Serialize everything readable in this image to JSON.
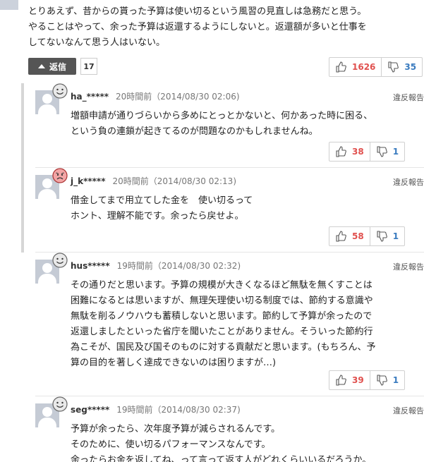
{
  "main": {
    "text": "とりあえず、昔からの貰った予算は使い切るという風習の見直しは急務だと思う。\nやることはやって、余った予算は返還するようにしないと。返還額が多いと仕事を\nしてないなんて思う人はいない。",
    "reply_label": "返信",
    "reply_count": "17",
    "good": "1626",
    "bad": "35"
  },
  "replies": [
    {
      "user": "ha_*****",
      "meta": "20時間前（2014/08/30 02:06)",
      "report": "違反報告",
      "mood": "neutral",
      "text": "増額申請が通りづらいから多めにとっとかないと、何かあった時に困る、\nという負の連鎖が起きてるのが問題なのかもしれませんね。",
      "good": "38",
      "bad": "1"
    },
    {
      "user": "j_k*****",
      "meta": "20時間前（2014/08/30 02:13)",
      "report": "違反報告",
      "mood": "angry",
      "text": "借金してまで用立てした金を　使い切るって\nホント、理解不能です。余ったら戻せよ。",
      "good": "58",
      "bad": "1"
    },
    {
      "user": "hus*****",
      "meta": "19時間前（2014/08/30 02:32)",
      "report": "違反報告",
      "mood": "neutral",
      "text": "その通りだと思います。予算の規模が大きくなるほど無駄を無くすことは\n困難になるとは思いますが、無理矢理使い切る制度では、節約する意識や\n無駄を削るノウハウも蓄積しないと思います。節約して予算が余ったので\n返還しましたといった省庁を聞いたことがありません。そういった節約行\n為こそが、国民及び国そのものに対する貢献だと思います。(もちろん、予\n算の目的を著しく達成できないのは困りますが…)",
      "good": "39",
      "bad": "1"
    },
    {
      "user": "seg*****",
      "meta": "19時間前（2014/08/30 02:37)",
      "report": "違反報告",
      "mood": "neutral",
      "text": "予算が余ったら、次年度予算が減らされるんです。\nそのために、使い切るパフォーマンスなんです。\n余ったらお金を返してね、って言って返す人がどれくらいいるだろうか。"
    }
  ],
  "colors": {
    "good": "#e0504e",
    "bad": "#3a7bbf",
    "neutral_mood": "#e9e9e9",
    "angry_mood": "#f3a5a5"
  },
  "icons": [
    "thumb-up-icon",
    "thumb-down-icon",
    "smile-face-icon",
    "angry-face-icon",
    "avatar-icon"
  ]
}
